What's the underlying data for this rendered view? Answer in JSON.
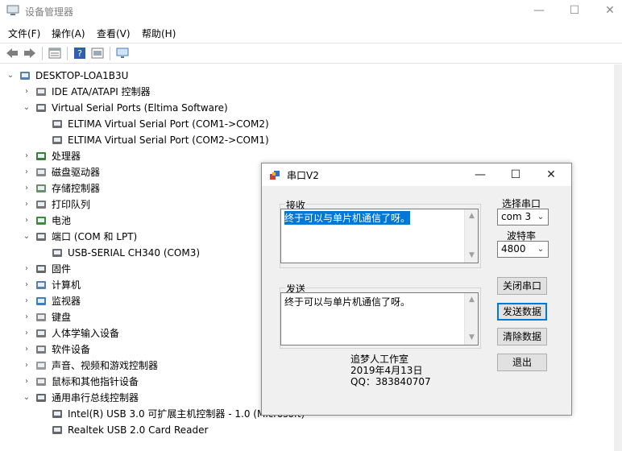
{
  "window": {
    "title": "设备管理器",
    "controls": {
      "minimize": "—",
      "maximize": "☐",
      "close": "✕"
    }
  },
  "menu": [
    "文件(F)",
    "操作(A)",
    "查看(V)",
    "帮助(H)"
  ],
  "toolbar": [
    "back-icon",
    "forward-icon",
    "properties-icon",
    "help-icon",
    "update-driver-icon",
    "monitor-icon"
  ],
  "tree": [
    {
      "label": "DESKTOP-LOA1B3U",
      "indent": 0,
      "expanded": true,
      "icon": "computer-icon"
    },
    {
      "label": "IDE ATA/ATAPI 控制器",
      "indent": 1,
      "expanded": false,
      "icon": "ide-icon"
    },
    {
      "label": "Virtual Serial Ports (Eltima Software)",
      "indent": 1,
      "expanded": true,
      "icon": "port-icon"
    },
    {
      "label": "ELTIMA Virtual Serial Port (COM1->COM2)",
      "indent": 2,
      "expanded": null,
      "icon": "port-icon"
    },
    {
      "label": "ELTIMA Virtual Serial Port (COM2->COM1)",
      "indent": 2,
      "expanded": null,
      "icon": "port-icon"
    },
    {
      "label": "处理器",
      "indent": 1,
      "expanded": false,
      "icon": "cpu-icon"
    },
    {
      "label": "磁盘驱动器",
      "indent": 1,
      "expanded": false,
      "icon": "disk-icon"
    },
    {
      "label": "存储控制器",
      "indent": 1,
      "expanded": false,
      "icon": "storage-icon"
    },
    {
      "label": "打印队列",
      "indent": 1,
      "expanded": false,
      "icon": "printer-icon"
    },
    {
      "label": "电池",
      "indent": 1,
      "expanded": false,
      "icon": "battery-icon"
    },
    {
      "label": "端口 (COM 和 LPT)",
      "indent": 1,
      "expanded": true,
      "icon": "port-icon"
    },
    {
      "label": "USB-SERIAL CH340 (COM3)",
      "indent": 2,
      "expanded": null,
      "icon": "port-icon"
    },
    {
      "label": "固件",
      "indent": 1,
      "expanded": false,
      "icon": "firmware-icon"
    },
    {
      "label": "计算机",
      "indent": 1,
      "expanded": false,
      "icon": "computer-icon"
    },
    {
      "label": "监视器",
      "indent": 1,
      "expanded": false,
      "icon": "monitor-icon"
    },
    {
      "label": "键盘",
      "indent": 1,
      "expanded": false,
      "icon": "keyboard-icon"
    },
    {
      "label": "人体学输入设备",
      "indent": 1,
      "expanded": false,
      "icon": "hid-icon"
    },
    {
      "label": "软件设备",
      "indent": 1,
      "expanded": false,
      "icon": "software-device-icon"
    },
    {
      "label": "声音、视频和游戏控制器",
      "indent": 1,
      "expanded": false,
      "icon": "sound-icon"
    },
    {
      "label": "鼠标和其他指针设备",
      "indent": 1,
      "expanded": false,
      "icon": "mouse-icon"
    },
    {
      "label": "通用串行总线控制器",
      "indent": 1,
      "expanded": true,
      "icon": "usb-icon"
    },
    {
      "label": "Intel(R) USB 3.0 可扩展主机控制器 - 1.0 (Microsoft)",
      "indent": 2,
      "expanded": null,
      "icon": "usb-icon"
    },
    {
      "label": "Realtek USB 2.0 Card Reader",
      "indent": 2,
      "expanded": null,
      "icon": "usb-icon"
    }
  ],
  "dialog": {
    "title": "串口V2",
    "controls": {
      "minimize": "—",
      "maximize": "☐",
      "close": "✕"
    },
    "receive": {
      "label": "接收",
      "text": "终于可以与单片机通信了呀。"
    },
    "send": {
      "label": "发送",
      "text": "终于可以与单片机通信了呀。"
    },
    "port": {
      "label": "选择串口",
      "value": "com 3"
    },
    "baud": {
      "label": "波特率",
      "value": "4800"
    },
    "buttons": {
      "close_port": "关闭串口",
      "send_data": "发送数据",
      "clear_data": "清除数据",
      "exit": "退出"
    },
    "info": {
      "studio": "追梦人工作室",
      "date": "2019年4月13日",
      "qq": "QQ：383840707"
    }
  }
}
